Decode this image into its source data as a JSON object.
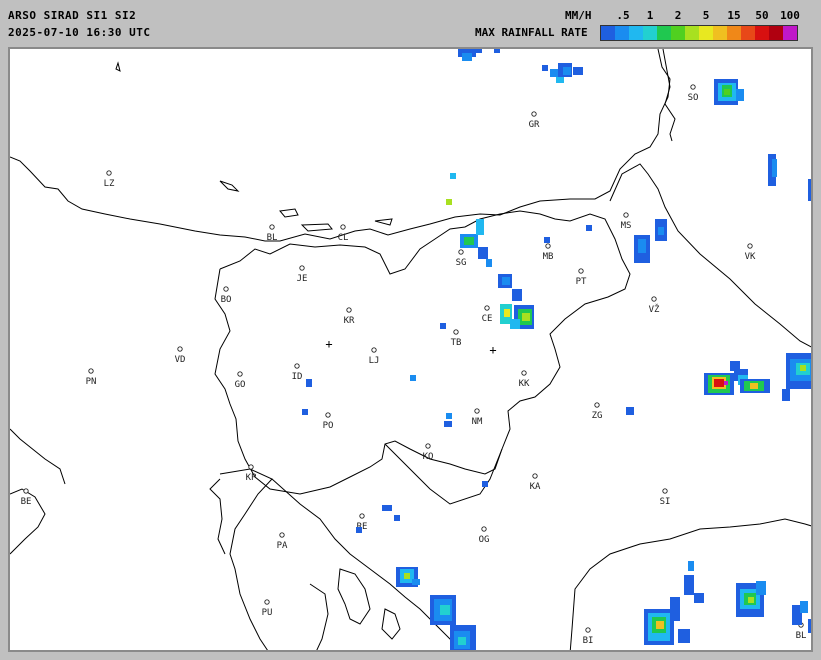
{
  "header": {
    "title": "ARSO SIRAD SI1 SI2",
    "datetime": "2025-07-10 16:30 UTC"
  },
  "legend": {
    "unit": "MM/H",
    "title": "MAX RAINFALL RATE",
    "labels": [
      ".5",
      "1",
      "2",
      "5",
      "15",
      "50",
      "100"
    ],
    "colors": [
      "#1f5fe0",
      "#1a8cf0",
      "#20b8f0",
      "#22d0d0",
      "#20c850",
      "#50d020",
      "#a8e020",
      "#e8e820",
      "#f0c020",
      "#f08818",
      "#e84818",
      "#d81010",
      "#b00010",
      "#c018c8"
    ]
  },
  "cities": [
    {
      "code": "GR"
    },
    {
      "code": "SO"
    },
    {
      "code": "LZ"
    },
    {
      "code": "BL"
    },
    {
      "code": "CL"
    },
    {
      "code": "MS"
    },
    {
      "code": "VK"
    },
    {
      "code": "MB"
    },
    {
      "code": "SG"
    },
    {
      "code": "JE"
    },
    {
      "code": "PT"
    },
    {
      "code": "BO"
    },
    {
      "code": "KR"
    },
    {
      "code": "CE"
    },
    {
      "code": "VŽ"
    },
    {
      "code": "TB"
    },
    {
      "code": "VD"
    },
    {
      "code": "LJ"
    },
    {
      "code": "PN"
    },
    {
      "code": "ID"
    },
    {
      "code": "GO"
    },
    {
      "code": "KK"
    },
    {
      "code": "NM"
    },
    {
      "code": "ZG"
    },
    {
      "code": "PO"
    },
    {
      "code": "KO"
    },
    {
      "code": "KP"
    },
    {
      "code": "KA"
    },
    {
      "code": "BE"
    },
    {
      "code": "SI"
    },
    {
      "code": "RE"
    },
    {
      "code": "OG"
    },
    {
      "code": "PA"
    },
    {
      "code": "PU"
    },
    {
      "code": "BI"
    },
    {
      "code": "BL"
    }
  ],
  "markers": [
    {
      "symbol": "+"
    },
    {
      "symbol": "+"
    }
  ],
  "icons": {
    "city": "circle-marker-icon",
    "radar_site": "cross-marker-icon"
  }
}
